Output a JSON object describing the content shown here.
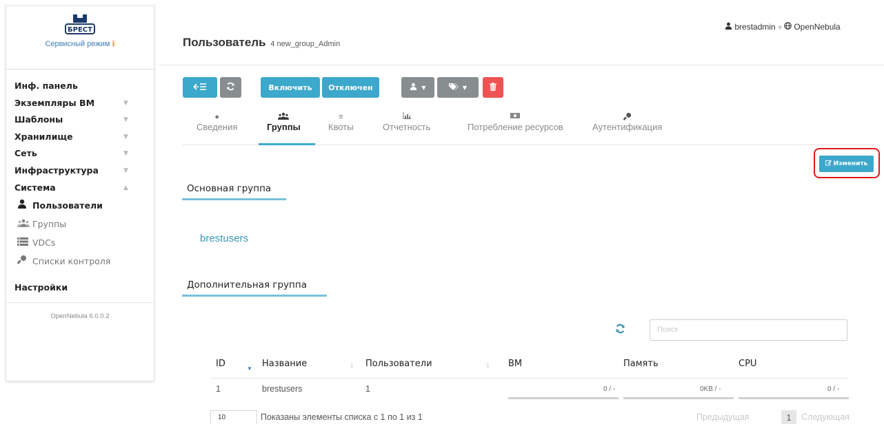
{
  "sidebar": {
    "logo_text": "БРЕСТ",
    "service_mode": "Сервисный режим",
    "items": [
      {
        "label": "Инф. панель"
      },
      {
        "label": "Экземпляры ВМ"
      },
      {
        "label": "Шаблоны"
      },
      {
        "label": "Хранилище"
      },
      {
        "label": "Сеть"
      },
      {
        "label": "Инфраструктура"
      },
      {
        "label": "Система"
      }
    ],
    "system_sub": [
      {
        "label": "Пользователи",
        "icon": "user-icon"
      },
      {
        "label": "Группы",
        "icon": "users-icon"
      },
      {
        "label": "VDCs",
        "icon": "vdc-icon"
      },
      {
        "label": "Списки контроля",
        "icon": "key-icon"
      }
    ],
    "settings": "Настройки",
    "version": "OpenNebula 6.0.0.2"
  },
  "header": {
    "title": "Пользователь",
    "subtitle": "4 new_group_Admin",
    "user": "brestadmin",
    "zone": "OpenNebula"
  },
  "toolbar": {
    "enable": "Включить",
    "disable": "Отключен"
  },
  "tabs": [
    {
      "label": "Сведения",
      "icon": "info-icon"
    },
    {
      "label": "Группы",
      "icon": "users-icon"
    },
    {
      "label": "Квоты",
      "icon": "quota-icon"
    },
    {
      "label": "Отчетность",
      "icon": "chart-icon"
    },
    {
      "label": "Потребление ресурсов",
      "icon": "money-icon"
    },
    {
      "label": "Аутентификация",
      "icon": "key-icon"
    }
  ],
  "edit_label": "Изменить",
  "primary_group": {
    "title": "Основная группа",
    "value": "brestusers"
  },
  "secondary_group": {
    "title": "Дополнительная группа"
  },
  "search": {
    "placeholder": "Поиск"
  },
  "table": {
    "columns": [
      "ID",
      "Название",
      "Пользователи",
      "ВМ",
      "Память",
      "CPU"
    ],
    "rows": [
      {
        "id": "1",
        "name": "brestusers",
        "users": "1",
        "vm": "0 / -",
        "memory": "0KB / -",
        "cpu": "0 / -"
      }
    ]
  },
  "footer": {
    "page_size": "10",
    "info": "Показаны элементы списка с 1 по 1 из 1",
    "prev": "Предыдущая",
    "page": "1",
    "next": "Следующая"
  },
  "colors": {
    "accent": "#3ca8cc",
    "danger": "#ee5353",
    "neutral_button": "#888d90",
    "highlight": "#e01818"
  }
}
